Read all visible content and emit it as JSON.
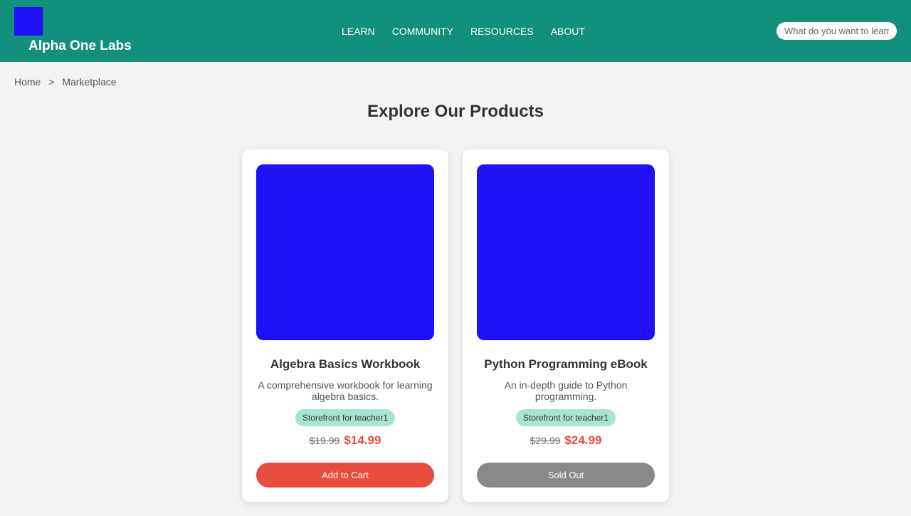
{
  "header": {
    "brand": "Alpha One Labs",
    "nav": [
      "LEARN",
      "COMMUNITY",
      "RESOURCES",
      "ABOUT"
    ],
    "search_placeholder": "What do you want to learn?"
  },
  "breadcrumb": {
    "home": "Home",
    "separator": ">",
    "current": "Marketplace"
  },
  "page_title": "Explore Our Products",
  "products": [
    {
      "title": "Algebra Basics Workbook",
      "description": "A comprehensive workbook for learning algebra basics.",
      "storefront": "Storefront for teacher1",
      "old_price": "$19.99",
      "price": "$14.99",
      "button": "Add to Cart"
    },
    {
      "title": "Python Programming eBook",
      "description": "An in-depth guide to Python programming.",
      "storefront": "Storefront for teacher1",
      "old_price": "$29.99",
      "price": "$24.99",
      "button": "Sold Out"
    }
  ],
  "colors": {
    "header_bg": "#13907b",
    "image_placeholder": "#1f10f5",
    "accent_red": "#e74c3c",
    "badge_bg": "#a8e3d4",
    "sold_out_gray": "#888888"
  }
}
